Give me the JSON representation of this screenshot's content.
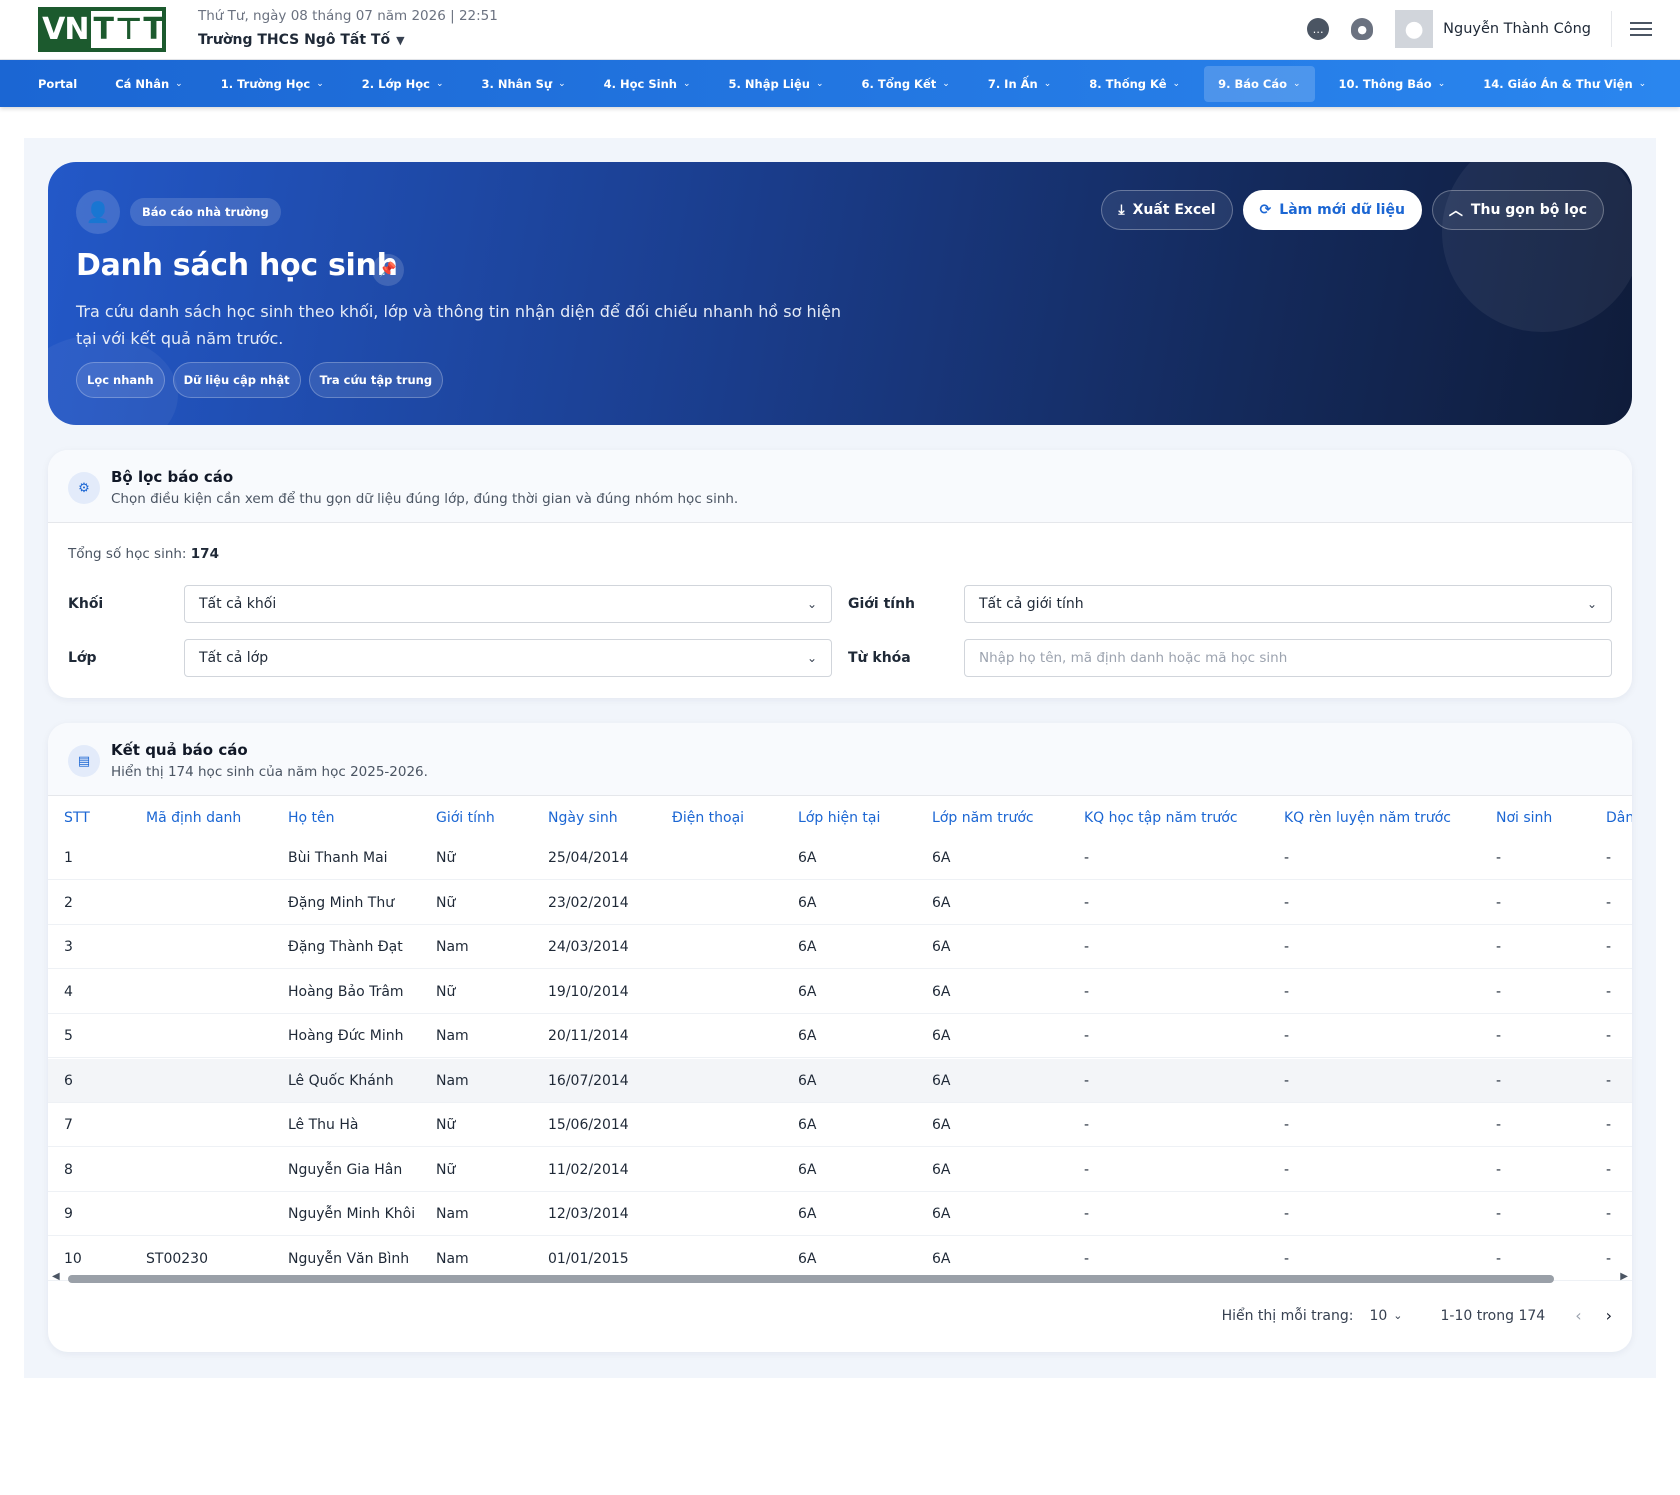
{
  "header": {
    "logo_text": "VNTT",
    "datetime": "Thứ Tư, ngày 08 tháng 07 năm 2026 | 22:51",
    "school": "Trường THCS Ngô Tất Tố",
    "username": "Nguyễn Thành Công"
  },
  "nav": [
    {
      "label": "Portal",
      "chevron": false
    },
    {
      "label": "Cá Nhân",
      "chevron": true
    },
    {
      "label": "1. Trường Học",
      "chevron": true
    },
    {
      "label": "2. Lớp Học",
      "chevron": true
    },
    {
      "label": "3. Nhân Sự",
      "chevron": true
    },
    {
      "label": "4. Học Sinh",
      "chevron": true
    },
    {
      "label": "5. Nhập Liệu",
      "chevron": true
    },
    {
      "label": "6. Tổng Kết",
      "chevron": true
    },
    {
      "label": "7. In Ấn",
      "chevron": true
    },
    {
      "label": "8. Thống Kê",
      "chevron": true
    },
    {
      "label": "9. Báo Cáo",
      "chevron": true,
      "active": true
    },
    {
      "label": "10. Thông Báo",
      "chevron": true
    },
    {
      "label": "14. Giáo Án & Thư Viện",
      "chevron": true
    }
  ],
  "hero": {
    "tag": "Báo cáo nhà trường",
    "title": "Danh sách học sinh",
    "description": "Tra cứu danh sách học sinh theo khối, lớp và thông tin nhận diện để đối chiếu nhanh hồ sơ hiện tại với kết quả năm trước.",
    "chips": [
      "Lọc nhanh",
      "Dữ liệu cập nhật",
      "Tra cứu tập trung"
    ],
    "buttons": {
      "export": "Xuất Excel",
      "refresh": "Làm mới dữ liệu",
      "collapse": "Thu gọn bộ lọc"
    }
  },
  "filter": {
    "title": "Bộ lọc báo cáo",
    "subtitle": "Chọn điều kiện cần xem để thu gọn dữ liệu đúng lớp, đúng thời gian và đúng nhóm học sinh.",
    "total_label": "Tổng số học sinh:",
    "total_value": "174",
    "khoi_label": "Khối",
    "khoi_value": "Tất cả khối",
    "gioitinh_label": "Giới tính",
    "gioitinh_value": "Tất cả giới tính",
    "lop_label": "Lớp",
    "lop_value": "Tất cả lớp",
    "tukhoa_label": "Từ khóa",
    "tukhoa_placeholder": "Nhập họ tên, mã định danh hoặc mã học sinh"
  },
  "result": {
    "title": "Kết quả báo cáo",
    "subtitle": "Hiển thị 174 học sinh của năm học 2025-2026.",
    "columns": [
      "STT",
      "Mã định danh",
      "Họ tên",
      "Giới tính",
      "Ngày sinh",
      "Điện thoại",
      "Lớp hiện tại",
      "Lớp năm trước",
      "KQ học tập năm trước",
      "KQ rèn luyện năm trước",
      "Nơi sinh",
      "Dân"
    ],
    "rows": [
      [
        "1",
        "",
        "Bùi Thanh Mai",
        "Nữ",
        "25/04/2014",
        "",
        "6A",
        "6A",
        "-",
        "-",
        "-",
        "-"
      ],
      [
        "2",
        "",
        "Đặng Minh Thư",
        "Nữ",
        "23/02/2014",
        "",
        "6A",
        "6A",
        "-",
        "-",
        "-",
        "-"
      ],
      [
        "3",
        "",
        "Đặng Thành Đạt",
        "Nam",
        "24/03/2014",
        "",
        "6A",
        "6A",
        "-",
        "-",
        "-",
        "-"
      ],
      [
        "4",
        "",
        "Hoàng Bảo Trâm",
        "Nữ",
        "19/10/2014",
        "",
        "6A",
        "6A",
        "-",
        "-",
        "-",
        "-"
      ],
      [
        "5",
        "",
        "Hoàng Đức Minh",
        "Nam",
        "20/11/2014",
        "",
        "6A",
        "6A",
        "-",
        "-",
        "-",
        "-"
      ],
      [
        "6",
        "",
        "Lê Quốc Khánh",
        "Nam",
        "16/07/2014",
        "",
        "6A",
        "6A",
        "-",
        "-",
        "-",
        "-"
      ],
      [
        "7",
        "",
        "Lê Thu Hà",
        "Nữ",
        "15/06/2014",
        "",
        "6A",
        "6A",
        "-",
        "-",
        "-",
        "-"
      ],
      [
        "8",
        "",
        "Nguyễn Gia Hân",
        "Nữ",
        "11/02/2014",
        "",
        "6A",
        "6A",
        "-",
        "-",
        "-",
        "-"
      ],
      [
        "9",
        "",
        "Nguyễn Minh Khôi",
        "Nam",
        "12/03/2014",
        "",
        "6A",
        "6A",
        "-",
        "-",
        "-",
        "-"
      ],
      [
        "10",
        "ST00230",
        "Nguyễn Văn Bình",
        "Nam",
        "01/01/2015",
        "",
        "6A",
        "6A",
        "-",
        "-",
        "-",
        "-"
      ]
    ],
    "highlighted_row": 6
  },
  "pagination": {
    "per_page_label": "Hiển thị mỗi trang:",
    "per_page": "10",
    "range": "1-10 trong 174"
  },
  "colors": {
    "primary": "#1b66d3",
    "logo_green": "#1c5a2e",
    "hero_dark": "#0f1c3a"
  }
}
